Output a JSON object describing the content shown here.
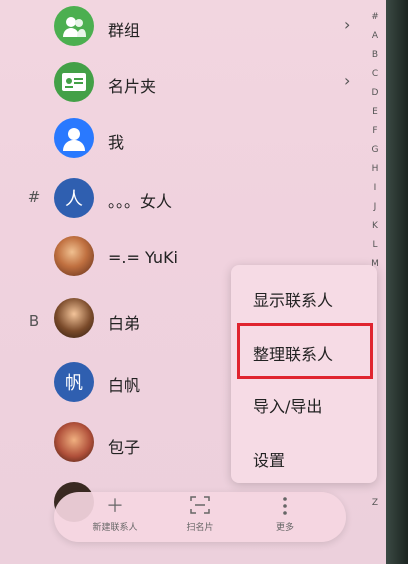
{
  "contacts": [
    {
      "label": "群组",
      "section": "",
      "avatar_color": "#4caf50",
      "avatar_text": "",
      "icon": "group-icon",
      "chevron": true
    },
    {
      "label": "名片夹",
      "section": "",
      "avatar_color": "#43a047",
      "avatar_text": "",
      "icon": "business-card-icon",
      "chevron": true
    },
    {
      "label": "我",
      "section": "",
      "avatar_color": "#2979ff",
      "avatar_text": "",
      "icon": "person-icon",
      "chevron": false
    },
    {
      "label": "。。。女人",
      "section": "#",
      "avatar_color": "#2f5fb0",
      "avatar_text": "人",
      "icon": "",
      "chevron": false
    },
    {
      "label": "=.= YuKi",
      "section": "",
      "avatar_color": "#c0703a",
      "avatar_text": "",
      "icon": "photo-avatar",
      "chevron": false
    },
    {
      "label": "白弟",
      "section": "B",
      "avatar_color": "#7a4a2a",
      "avatar_text": "",
      "icon": "photo-avatar",
      "chevron": false
    },
    {
      "label": "白帆",
      "section": "",
      "avatar_color": "#2f5fb0",
      "avatar_text": "帆",
      "icon": "",
      "chevron": false
    },
    {
      "label": "包子",
      "section": "",
      "avatar_color": "#b0503a",
      "avatar_text": "",
      "icon": "photo-avatar",
      "chevron": false
    }
  ],
  "index_letters": [
    "#",
    "A",
    "B",
    "C",
    "D",
    "E",
    "F",
    "G",
    "H",
    "I",
    "J",
    "K",
    "L",
    "M",
    "Z"
  ],
  "menu": {
    "items": [
      "显示联系人",
      "整理联系人",
      "导入/导出",
      "设置"
    ],
    "highlighted": "整理联系人",
    "highlight_color": "#e0242f"
  },
  "bottom_bar": {
    "new_contact": "新建联系人",
    "scan_card": "扫名片",
    "more": "更多"
  }
}
